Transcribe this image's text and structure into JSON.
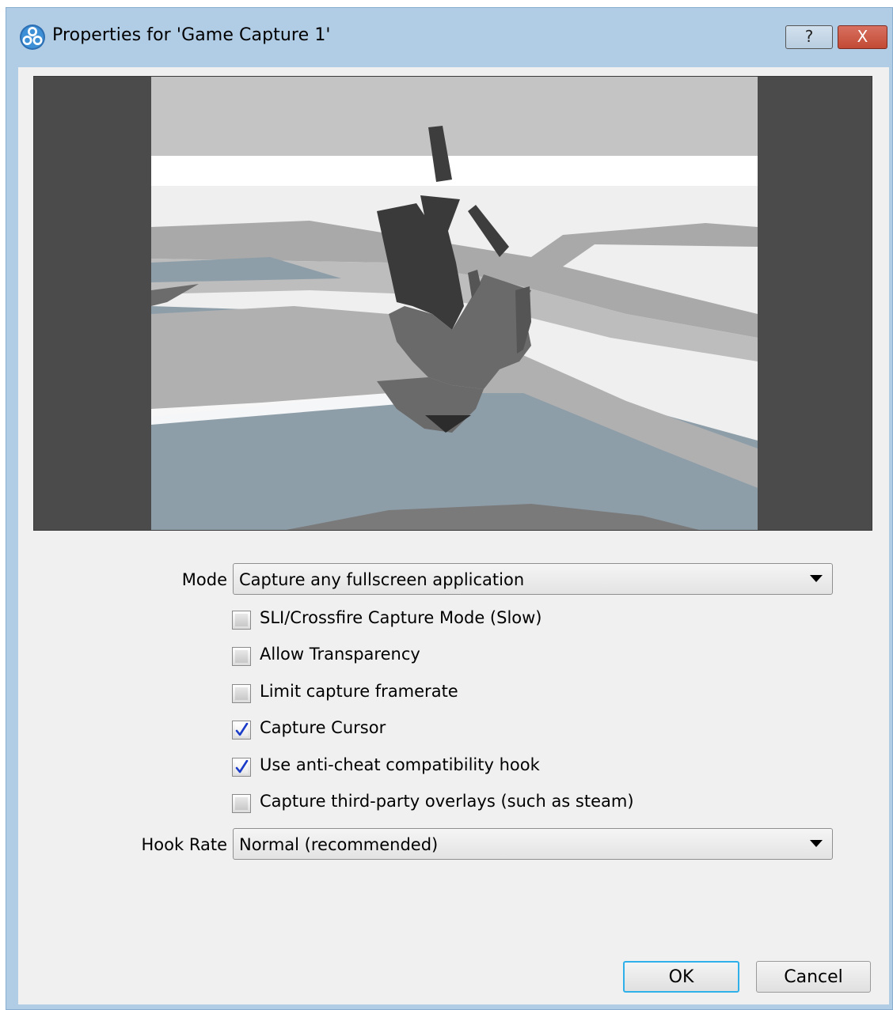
{
  "window": {
    "title": "Properties for 'Game Capture 1'",
    "help_label": "?",
    "close_label": "X"
  },
  "form": {
    "mode_label": "Mode",
    "mode_value": "Capture any fullscreen application",
    "hook_rate_label": "Hook Rate",
    "hook_rate_value": "Normal (recommended)",
    "options": [
      {
        "label": "SLI/Crossfire Capture Mode (Slow)",
        "checked": false
      },
      {
        "label": "Allow Transparency",
        "checked": false
      },
      {
        "label": "Limit capture framerate",
        "checked": false
      },
      {
        "label": "Capture Cursor",
        "checked": true
      },
      {
        "label": "Use anti-cheat compatibility hook",
        "checked": true
      },
      {
        "label": "Capture third-party overlays (such as steam)",
        "checked": false
      }
    ]
  },
  "buttons": {
    "ok": "OK",
    "cancel": "Cancel"
  },
  "colors": {
    "titlebar": "#b1cce5",
    "client_bg": "#f0f0f0",
    "focus_border": "#2fb0e8",
    "close_button": "#c24a35",
    "checkmark": "#1a3cc8"
  },
  "icons": {
    "app": "obs-logo-icon",
    "dropdown": "chevron-down-icon",
    "check": "checkmark-icon"
  }
}
